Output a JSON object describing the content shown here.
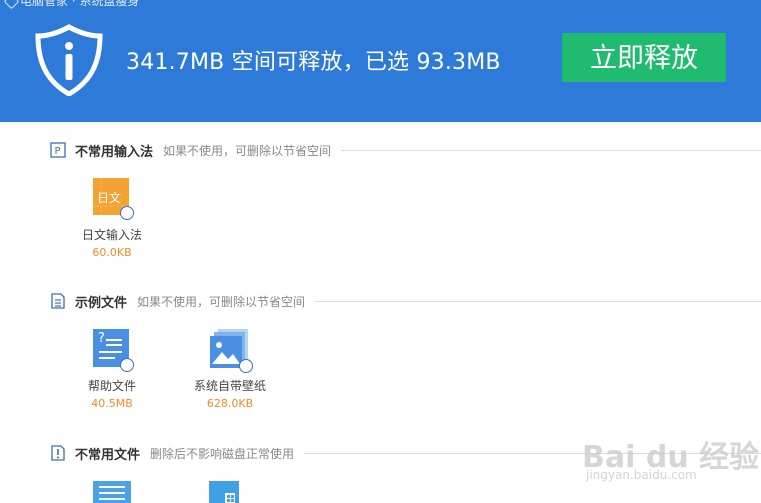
{
  "window": {
    "title": "电脑管家 · 系统盘瘦身"
  },
  "header": {
    "headline": "341.7MB 空间可释放，已选 93.3MB",
    "release_button": "立即释放",
    "brand_icon": "shield-info-icon",
    "bg_color": "#2d7ad8",
    "button_color": "#1fbb6e"
  },
  "sections": [
    {
      "title": "不常用输入法",
      "desc": "如果不使用，可删除以节省空间",
      "icon": "keyboard-p-icon",
      "items": [
        {
          "icon_text": "日文",
          "label": "日文输入法",
          "size": "60.0KB"
        }
      ]
    },
    {
      "title": "示例文件",
      "desc": "如果不使用，可删除以节省空间",
      "icon": "document-icon",
      "items": [
        {
          "icon_text": "?",
          "label": "帮助文件",
          "size": "40.5MB"
        },
        {
          "label": "系统自带壁纸",
          "size": "628.0KB"
        }
      ]
    },
    {
      "title": "不常用文件",
      "desc": "删除后不影响磁盘正常使用",
      "icon": "alert-file-icon",
      "items": []
    }
  ],
  "watermark": {
    "main": "Bai du 经验",
    "sub": "jingyan.baidu.com"
  },
  "colors": {
    "size_text": "#f08a2b",
    "check_border": "#3d6fb8"
  }
}
